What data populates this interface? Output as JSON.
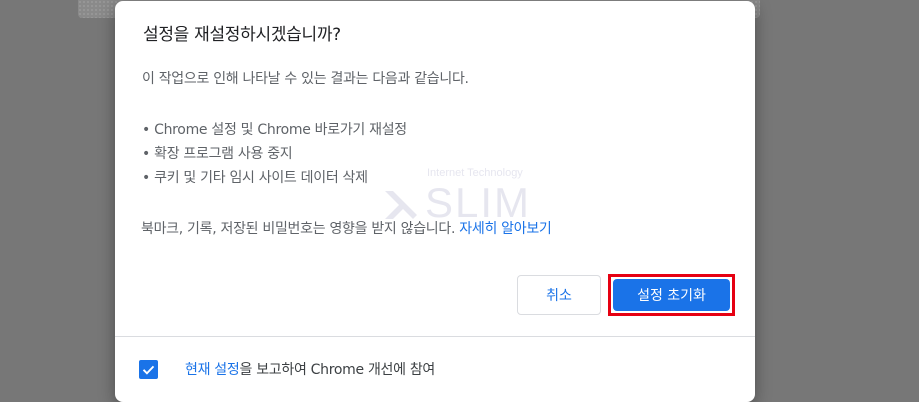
{
  "dialog": {
    "title": "설정을 재설정하시겠습니까?",
    "description": "이 작업으로 인해 나타날 수 있는 결과는 다음과 같습니다.",
    "bullets": [
      "Chrome 설정 및 Chrome 바로가기 재설정",
      "확장 프로그램 사용 중지",
      "쿠키 및 기타 임시 사이트 데이터 삭제"
    ],
    "note": "북마크, 기록, 저장된 비밀번호는 영향을 받지 않습니다.",
    "learn_more_link": "자세히 알아보기",
    "cancel_label": "취소",
    "reset_label": "설정 초기화",
    "footer": {
      "checkbox_checked": true,
      "link_text": "현재 설정",
      "text": "을 보고하여 Chrome 개선에 참여"
    }
  },
  "watermark": {
    "subtitle": "Internet Technology",
    "name": "SLIM"
  },
  "colors": {
    "accent": "#1a73e8",
    "highlight_border": "#e60012",
    "overlay": "#777777"
  }
}
